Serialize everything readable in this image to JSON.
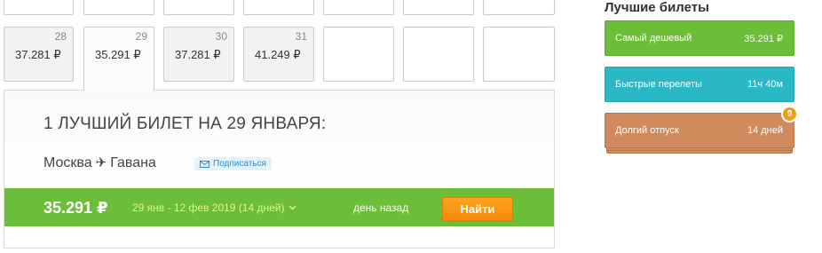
{
  "calendar": {
    "top_row": [
      {
        "day": "",
        "price": ""
      },
      {
        "day": "",
        "price": ""
      },
      {
        "day": "",
        "price": ""
      },
      {
        "day": "",
        "price": ""
      },
      {
        "day": "",
        "price": ""
      },
      {
        "day": "",
        "price": ""
      },
      {
        "day": "",
        "price": ""
      }
    ],
    "cells": [
      {
        "day": "28",
        "price": "37.281 ₽"
      },
      {
        "day": "29",
        "price": "35.291 ₽",
        "active": true
      },
      {
        "day": "30",
        "price": "37.281 ₽"
      },
      {
        "day": "31",
        "price": "41.249 ₽"
      },
      {
        "day": "",
        "price": ""
      },
      {
        "day": "",
        "price": ""
      },
      {
        "day": "",
        "price": ""
      }
    ]
  },
  "offer": {
    "title": "1 ЛУЧШИЙ БИЛЕТ НА 29 ЯНВАРЯ:",
    "from": "Москва",
    "to": "Гавана",
    "plane_glyph": "✈",
    "subscribe_label": "Подписаться",
    "price": "35.291 ₽",
    "dates": "29 янв - 12 фев 2019 (14 дней)",
    "ago": "день назад",
    "find_label": "Найти"
  },
  "best": {
    "title": "Лучшие билеты",
    "cards": [
      {
        "label": "Самый дешевый",
        "value": "35.291 ₽",
        "color": "#6cbd37"
      },
      {
        "label": "Быстрые перелеты",
        "value": "11ч 40м",
        "color": "#2bb8c5"
      },
      {
        "label": "Долгий отпуск",
        "value": "14 дней",
        "color": "#cf8a5e",
        "badge": "9"
      }
    ]
  },
  "icons": {
    "plane": "plane-icon",
    "envelope": "envelope-icon",
    "chevron": "chevron-down-icon"
  }
}
